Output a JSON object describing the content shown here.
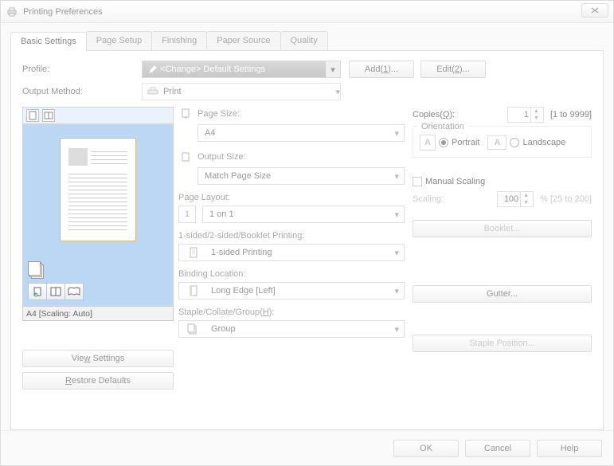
{
  "window": {
    "title": "Printing Preferences"
  },
  "tabs": [
    "Basic Settings",
    "Page Setup",
    "Finishing",
    "Paper Source",
    "Quality"
  ],
  "active_tab": 0,
  "profile": {
    "label": "Profile:",
    "value": "<Change> Default Settings",
    "add": "Add(1)...",
    "edit": "Edit(2)..."
  },
  "output_method": {
    "label": "Output Method:",
    "value": "Print"
  },
  "preview": {
    "status": "A4 [Scaling: Auto]",
    "view_settings": "View Settings",
    "restore_defaults": "Restore Defaults"
  },
  "page_size": {
    "label": "Page Size:",
    "value": "A4"
  },
  "output_size": {
    "label": "Output Size:",
    "value": "Match Page Size"
  },
  "page_layout": {
    "label": "Page Layout:",
    "value": "1 on 1",
    "icon_text": "1"
  },
  "printing": {
    "label": "1-sided/2-sided/Booklet Printing:",
    "value": "1-sided Printing"
  },
  "binding": {
    "label": "Binding Location:",
    "value": "Long Edge [Left]"
  },
  "staple": {
    "label": "Staple/Collate/Group(H):",
    "value": "Group"
  },
  "copies": {
    "label": "Copies(Q):",
    "value": "1",
    "range": "[1 to 9999]"
  },
  "orientation": {
    "legend": "Orientation",
    "portrait": "Portrait",
    "landscape": "Landscape",
    "selected": "portrait"
  },
  "manual_scaling": {
    "label": "Manual Scaling"
  },
  "scaling": {
    "label": "Scaling:",
    "value": "100",
    "range": "% [25 to 200]"
  },
  "right_buttons": {
    "booklet": "Booklet...",
    "gutter": "Gutter...",
    "staple_position": "Staple Position..."
  },
  "footer": {
    "ok": "OK",
    "cancel": "Cancel",
    "help": "Help"
  }
}
